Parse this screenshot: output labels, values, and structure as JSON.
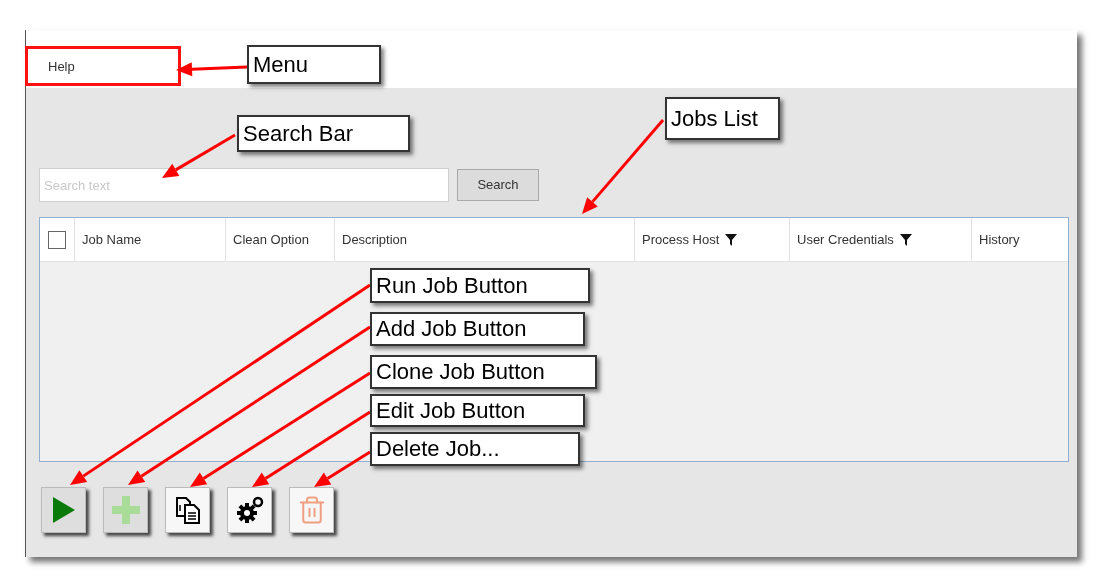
{
  "menu": [
    {
      "label": "Help"
    }
  ],
  "search": {
    "placeholder": "Search text",
    "button": "Search"
  },
  "table": {
    "select_all": {
      "checked": false
    },
    "columns": [
      {
        "label": "Job Name",
        "filter": false
      },
      {
        "label": "Clean Option",
        "filter": false
      },
      {
        "label": "Description",
        "filter": false
      },
      {
        "label": "Process Host",
        "filter": true
      },
      {
        "label": "User Credentials",
        "filter": true
      },
      {
        "label": "History",
        "filter": false
      }
    ]
  },
  "toolbar": [
    {
      "kind": "run",
      "disabled": false
    },
    {
      "kind": "add",
      "disabled": true
    },
    {
      "kind": "clone",
      "disabled": false
    },
    {
      "kind": "edit",
      "disabled": false
    },
    {
      "kind": "delete",
      "disabled": true
    }
  ],
  "annotations": [
    {
      "label": "Menu"
    },
    {
      "label": "Search Bar"
    },
    {
      "label": "Jobs List"
    },
    {
      "label": "Run Job Button"
    },
    {
      "label": "Add Job Button"
    },
    {
      "label": "Clone Job Button"
    },
    {
      "label": "Edit Job Button"
    },
    {
      "label": "Delete Job..."
    }
  ]
}
